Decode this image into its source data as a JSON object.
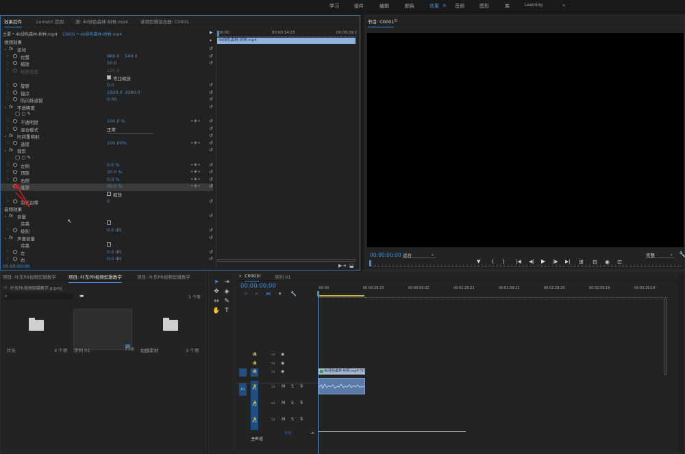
{
  "workspaces": [
    "学习",
    "组件",
    "编辑",
    "颜色",
    "效果",
    "音频",
    "图形",
    "库",
    "Learning",
    "»"
  ],
  "active_workspace": "效果",
  "effect_controls": {
    "tabs": [
      "效果控件",
      "Lumetri 范围",
      "源: 4k绿色森林-树林.mp4",
      "音频剪辑混合器: C0001"
    ],
    "master_label": "主要 * 4k绿色森林-树林.mp4",
    "sequence_label": "C0001 * 4k绿色森林-树林.mp4",
    "timecodes": [
      "00:00",
      "00:00:14:23",
      "00:00:29:2"
    ],
    "clip_bar_label": "4k绿色森林-树林.mp4",
    "section_video": "视频效果",
    "section_audio": "音频效果",
    "rows": [
      {
        "label": "运动",
        "fx": true
      },
      {
        "label": "位置",
        "v1": "960.0",
        "v2": "540.0"
      },
      {
        "label": "缩放",
        "v1": "50.0"
      },
      {
        "label": "缩放宽度",
        "v1": "100.0",
        "dim": true
      },
      {
        "label": "等比缩放",
        "checkbox": true
      },
      {
        "label": "旋转",
        "v1": "0.0"
      },
      {
        "label": "锚点",
        "v1": "1920.0",
        "v2": "1080.0"
      },
      {
        "label": "防闪烁滤镜",
        "v1": "0.00"
      },
      {
        "label": "不透明度",
        "fx": true
      },
      {
        "label": "",
        "shapes": true
      },
      {
        "label": "不透明度",
        "v1": "100.0 %"
      },
      {
        "label": "混合模式",
        "v1": "正常",
        "dropdown": true
      },
      {
        "label": "时间重映射",
        "fx": true
      },
      {
        "label": "速度",
        "v1": "100.00%"
      },
      {
        "label": "裁剪",
        "fx": true
      },
      {
        "label": "",
        "shapes": true
      },
      {
        "label": "左侧",
        "v1": "0.0 %"
      },
      {
        "label": "顶部",
        "v1": "30.0 %"
      },
      {
        "label": "右侧",
        "v1": "0.0 %"
      },
      {
        "label": "底部",
        "v1": "30.0 %",
        "selected": true
      },
      {
        "label": "缩放",
        "checkbox": true
      },
      {
        "label": "羽化边缘",
        "v1": "0"
      },
      {
        "label": "音量",
        "fx": true
      },
      {
        "label": "旁路",
        "checkbox": true
      },
      {
        "label": "级别",
        "v1": "0.0 dB"
      },
      {
        "label": "声道音量",
        "fx": true
      },
      {
        "label": "旁路",
        "checkbox": true
      },
      {
        "label": "左",
        "v1": "0.0 dB"
      },
      {
        "label": "右",
        "v1": "0.0 dB"
      }
    ],
    "current_time": "00:00:00:00"
  },
  "program": {
    "title": "节目: C0001",
    "timecode": "00:00:00:00",
    "fit": "适合",
    "quality": "完整",
    "transport": [
      "▼",
      "{",
      "}",
      "|◀",
      "◀|",
      "▶",
      "|▶",
      "▶|",
      "⊞",
      "⊟",
      "◉",
      "⊡"
    ]
  },
  "project": {
    "tabs": [
      "项目: 叶东PR视频剪辑教学",
      "项目: 叶东PR视频剪辑教学",
      "项目: 叶东PR视频剪辑教学"
    ],
    "file": "叶东PR视频剪辑教学.prproj",
    "count": "3 个项",
    "bins": [
      {
        "name": "片头",
        "count": "4 个项",
        "type": "folder"
      },
      {
        "name": "序列 01",
        "count": "7:00",
        "type": "sequence"
      },
      {
        "name": "拍摄素材",
        "count": "3 个项",
        "type": "folder"
      }
    ]
  },
  "timeline": {
    "tab_close": "×",
    "tabs": [
      "C0001",
      "序列 01"
    ],
    "timecode": "00:00:00:00",
    "ruler": [
      ":00:00",
      "00:00:29:23",
      "00:00:59:22",
      "00:01:29:21",
      "00:01:59:21",
      "00:02:29:20",
      "00:02:59:19",
      "00:03:29:18"
    ],
    "video_tracks": [
      "V3",
      "V2",
      "V1"
    ],
    "audio_tracks": [
      "A1",
      "A2",
      "A3"
    ],
    "master": "主声道",
    "master_value": "0.0",
    "clip_label": "4k绿色森林-树林.mp4 [V]"
  }
}
